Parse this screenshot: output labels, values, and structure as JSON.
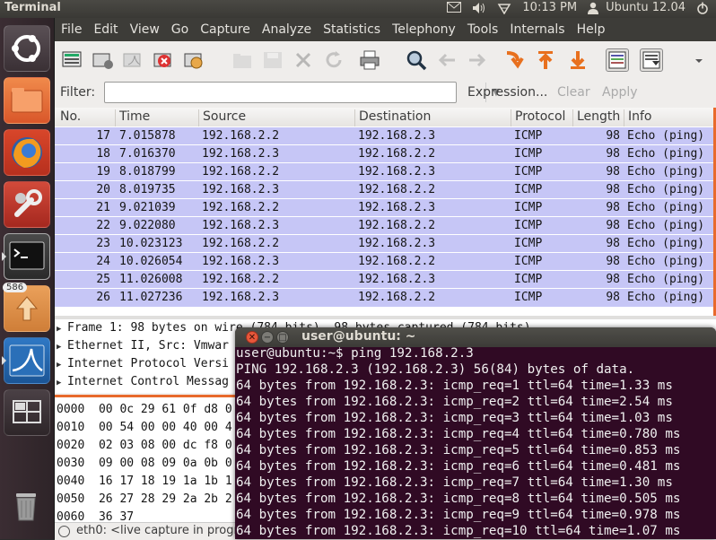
{
  "top_panel": {
    "title": "Terminal",
    "clock": "10:13 PM",
    "user": "Ubuntu 12.04"
  },
  "launcher": {
    "badge_count": "586",
    "items": [
      "ubuntu-dash",
      "files",
      "firefox",
      "system-settings",
      "terminal",
      "update-manager",
      "wireshark",
      "workspaces",
      "trash"
    ]
  },
  "wireshark": {
    "menu": [
      "File",
      "Edit",
      "View",
      "Go",
      "Capture",
      "Analyze",
      "Statistics",
      "Telephony",
      "Tools",
      "Internals",
      "Help"
    ],
    "filter": {
      "label": "Filter:",
      "value": "",
      "expression": "Expression...",
      "clear": "Clear",
      "apply": "Apply"
    },
    "columns": [
      "No.",
      "Time",
      "Source",
      "Destination",
      "Protocol",
      "Length",
      "Info"
    ],
    "packets": [
      {
        "no": "17",
        "time": "7.015878",
        "src": "192.168.2.2",
        "dst": "192.168.2.3",
        "proto": "ICMP",
        "len": "98",
        "info": "Echo (ping)"
      },
      {
        "no": "18",
        "time": "7.016370",
        "src": "192.168.2.3",
        "dst": "192.168.2.2",
        "proto": "ICMP",
        "len": "98",
        "info": "Echo (ping)"
      },
      {
        "no": "19",
        "time": "8.018799",
        "src": "192.168.2.2",
        "dst": "192.168.2.3",
        "proto": "ICMP",
        "len": "98",
        "info": "Echo (ping)"
      },
      {
        "no": "20",
        "time": "8.019735",
        "src": "192.168.2.3",
        "dst": "192.168.2.2",
        "proto": "ICMP",
        "len": "98",
        "info": "Echo (ping)"
      },
      {
        "no": "21",
        "time": "9.021039",
        "src": "192.168.2.2",
        "dst": "192.168.2.3",
        "proto": "ICMP",
        "len": "98",
        "info": "Echo (ping)"
      },
      {
        "no": "22",
        "time": "9.022080",
        "src": "192.168.2.3",
        "dst": "192.168.2.2",
        "proto": "ICMP",
        "len": "98",
        "info": "Echo (ping)"
      },
      {
        "no": "23",
        "time": "10.023123",
        "src": "192.168.2.2",
        "dst": "192.168.2.3",
        "proto": "ICMP",
        "len": "98",
        "info": "Echo (ping)"
      },
      {
        "no": "24",
        "time": "10.026054",
        "src": "192.168.2.3",
        "dst": "192.168.2.2",
        "proto": "ICMP",
        "len": "98",
        "info": "Echo (ping)"
      },
      {
        "no": "25",
        "time": "11.026008",
        "src": "192.168.2.2",
        "dst": "192.168.2.3",
        "proto": "ICMP",
        "len": "98",
        "info": "Echo (ping)"
      },
      {
        "no": "26",
        "time": "11.027236",
        "src": "192.168.2.3",
        "dst": "192.168.2.2",
        "proto": "ICMP",
        "len": "98",
        "info": "Echo (ping)"
      }
    ],
    "details": [
      "Frame 1: 98 bytes on wire (784 bits), 98 bytes captured (784 bits)",
      "Ethernet II, Src: Vmwar",
      "Internet Protocol Versi",
      "Internet Control Messag"
    ],
    "hex": [
      "0000  00 0c 29 61 0f d8 0",
      "0010  00 54 00 00 40 00 4",
      "0020  02 03 08 00 dc f8 0",
      "0030  09 00 08 09 0a 0b 0",
      "0040  16 17 18 19 1a 1b 1",
      "0050  26 27 28 29 2a 2b 2",
      "0060  36 37"
    ],
    "status": "eth0: <live capture in progr"
  },
  "terminal": {
    "title": "user@ubuntu: ~",
    "lines": [
      "user@ubuntu:~$ ping 192.168.2.3",
      "PING 192.168.2.3 (192.168.2.3) 56(84) bytes of data.",
      "64 bytes from 192.168.2.3: icmp_req=1 ttl=64 time=1.33 ms",
      "64 bytes from 192.168.2.3: icmp_req=2 ttl=64 time=2.54 ms",
      "64 bytes from 192.168.2.3: icmp_req=3 ttl=64 time=1.03 ms",
      "64 bytes from 192.168.2.3: icmp_req=4 ttl=64 time=0.780 ms",
      "64 bytes from 192.168.2.3: icmp_req=5 ttl=64 time=0.853 ms",
      "64 bytes from 192.168.2.3: icmp_req=6 ttl=64 time=0.481 ms",
      "64 bytes from 192.168.2.3: icmp_req=7 ttl=64 time=1.30 ms",
      "64 bytes from 192.168.2.3: icmp_req=8 ttl=64 time=0.505 ms",
      "64 bytes from 192.168.2.3: icmp_req=9 ttl=64 time=0.978 ms",
      "64 bytes from 192.168.2.3: icmp_req=10 ttl=64 time=1.07 ms"
    ]
  },
  "colors": {
    "packet_row": "#c6c6f6",
    "terminal_bg": "#300a24",
    "accent": "#e86a2c"
  }
}
